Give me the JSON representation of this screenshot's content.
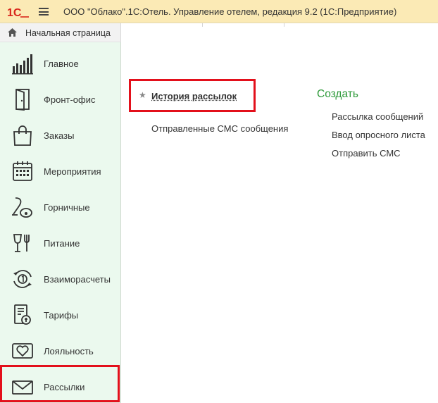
{
  "window": {
    "title": "ООО \"Облако\".1С:Отель. Управление отелем, редакция 9.2  (1С:Предприятие)"
  },
  "home": {
    "label": "Начальная страница"
  },
  "sidebar": {
    "items": [
      {
        "label": "Главное",
        "icon": "chart-bars-icon"
      },
      {
        "label": "Фронт-офис",
        "icon": "door-icon"
      },
      {
        "label": "Заказы",
        "icon": "shopping-bag-icon"
      },
      {
        "label": "Мероприятия",
        "icon": "calendar-icon"
      },
      {
        "label": "Горничные",
        "icon": "vacuum-cleaner-icon"
      },
      {
        "label": "Питание",
        "icon": "cup-fork-icon"
      },
      {
        "label": "Взаиморасчеты",
        "icon": "settlement-cycle-icon"
      },
      {
        "label": "Тарифы",
        "icon": "tariff-card-icon"
      },
      {
        "label": "Лояльность",
        "icon": "heart-card-icon"
      },
      {
        "label": "Рассылки",
        "icon": "envelope-icon"
      }
    ]
  },
  "main": {
    "history_link": "История рассылок",
    "sms_sent": "Отправленные СМС сообщения",
    "create": {
      "title": "Создать",
      "items": [
        "Рассылка сообщений",
        "Ввод опросного листа",
        "Отправить СМС"
      ]
    }
  },
  "colors": {
    "titlebar": "#fbeab5",
    "sidebar": "#ebf9ee",
    "create_title": "#2e9a3a",
    "highlight": "#e3101b",
    "logo": "#d9261c"
  }
}
